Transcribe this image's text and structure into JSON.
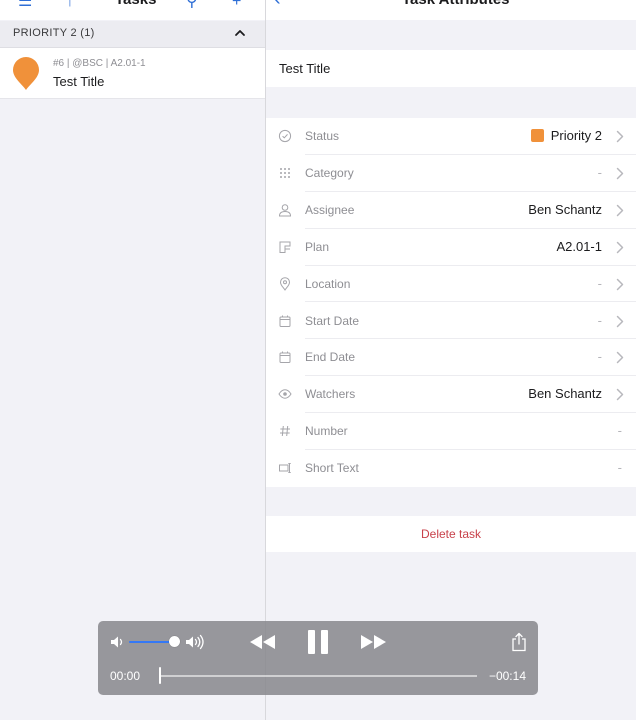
{
  "nav": {
    "left_title": "Tasks",
    "right_title": "Task Attributes"
  },
  "left": {
    "section_title": "PRIORITY 2 (1)",
    "task": {
      "meta": "#6 | @BSC | A2.01-1",
      "title": "Test Title",
      "pin_color": "#f0913a"
    }
  },
  "right": {
    "title_field": "Test Title",
    "attributes": [
      {
        "label": "Status",
        "value": "Priority 2",
        "swatch": "#f0913a",
        "icon": "check-circle-icon"
      },
      {
        "label": "Category",
        "value": "-",
        "icon": "grid-dots-icon"
      },
      {
        "label": "Assignee",
        "value": "Ben Schantz",
        "icon": "person-icon"
      },
      {
        "label": "Plan",
        "value": "A2.01-1",
        "icon": "plan-icon"
      },
      {
        "label": "Location",
        "value": "-",
        "icon": "location-pin-icon"
      },
      {
        "label": "Start Date",
        "value": "-",
        "icon": "calendar-icon"
      },
      {
        "label": "End Date",
        "value": "-",
        "icon": "calendar-icon"
      },
      {
        "label": "Watchers",
        "value": "Ben Schantz",
        "icon": "eye-icon"
      },
      {
        "label": "Number",
        "value": "-",
        "icon": "hash-icon"
      },
      {
        "label": "Short Text",
        "value": "-",
        "icon": "text-field-icon"
      }
    ],
    "delete_label": "Delete task"
  },
  "player": {
    "current_time": "00:00",
    "remaining_time": "−00:14",
    "volume_level": 0.75,
    "progress": 0.0
  },
  "colors": {
    "accent": "#3478f6",
    "status_orange": "#f0913a",
    "destructive": "#c8414a"
  }
}
